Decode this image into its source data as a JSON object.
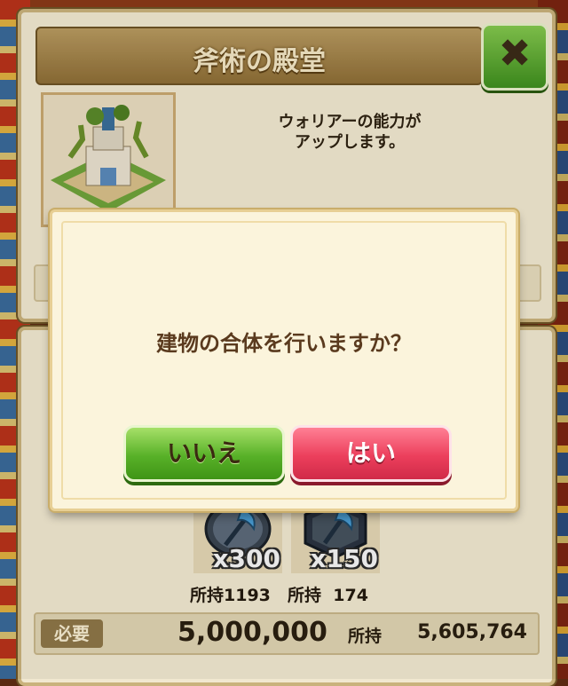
{
  "panel": {
    "title": "斧術の殿堂",
    "close_label": "✖",
    "description_line1": "ウォリアーの能力が",
    "description_line2": "アップします。"
  },
  "materials": [
    {
      "icon": "axe-shield-icon",
      "quantity": "x300",
      "owned_label": "所持",
      "owned_value": "1193"
    },
    {
      "icon": "axe-hexagon-icon",
      "quantity": "x150",
      "owned_label": "所持",
      "owned_value": "174"
    }
  ],
  "requirement": {
    "label": "必要",
    "amount": "5,000,000",
    "owned_label": "所持",
    "owned_amount": "5,605,764"
  },
  "dialog": {
    "message": "建物の合体を行いますか？",
    "no_label": "いいえ",
    "yes_label": "はい"
  },
  "colors": {
    "no_button": "#58b128",
    "yes_button": "#ec3f5c",
    "panel_bg": "#f1e8d0",
    "dialog_bg": "#fbf4dc"
  }
}
